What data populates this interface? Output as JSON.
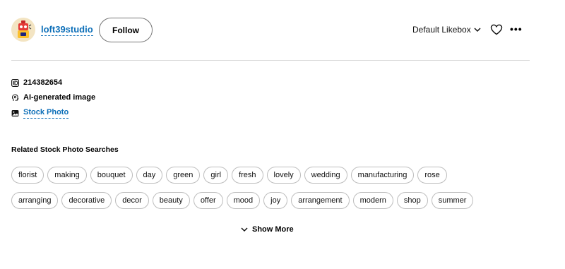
{
  "header": {
    "username": "loft39studio",
    "follow_label": "Follow",
    "likebox_label": "Default Likebox",
    "more_label": "•••"
  },
  "meta": {
    "image_id": "214382654",
    "ai_label": "AI-generated image",
    "stock_label": "Stock Photo"
  },
  "related": {
    "title": "Related Stock Photo Searches",
    "row1": [
      "florist",
      "making",
      "bouquet",
      "day",
      "green",
      "girl",
      "fresh",
      "lovely",
      "wedding",
      "manufacturing",
      "rose"
    ],
    "row2": [
      "arranging",
      "decorative",
      "decor",
      "beauty",
      "offer",
      "mood",
      "joy",
      "arrangement",
      "modern",
      "shop",
      "summer"
    ],
    "show_more_label": "Show More"
  },
  "colors": {
    "link": "#0d6fb8",
    "border": "#bdbdbd"
  }
}
